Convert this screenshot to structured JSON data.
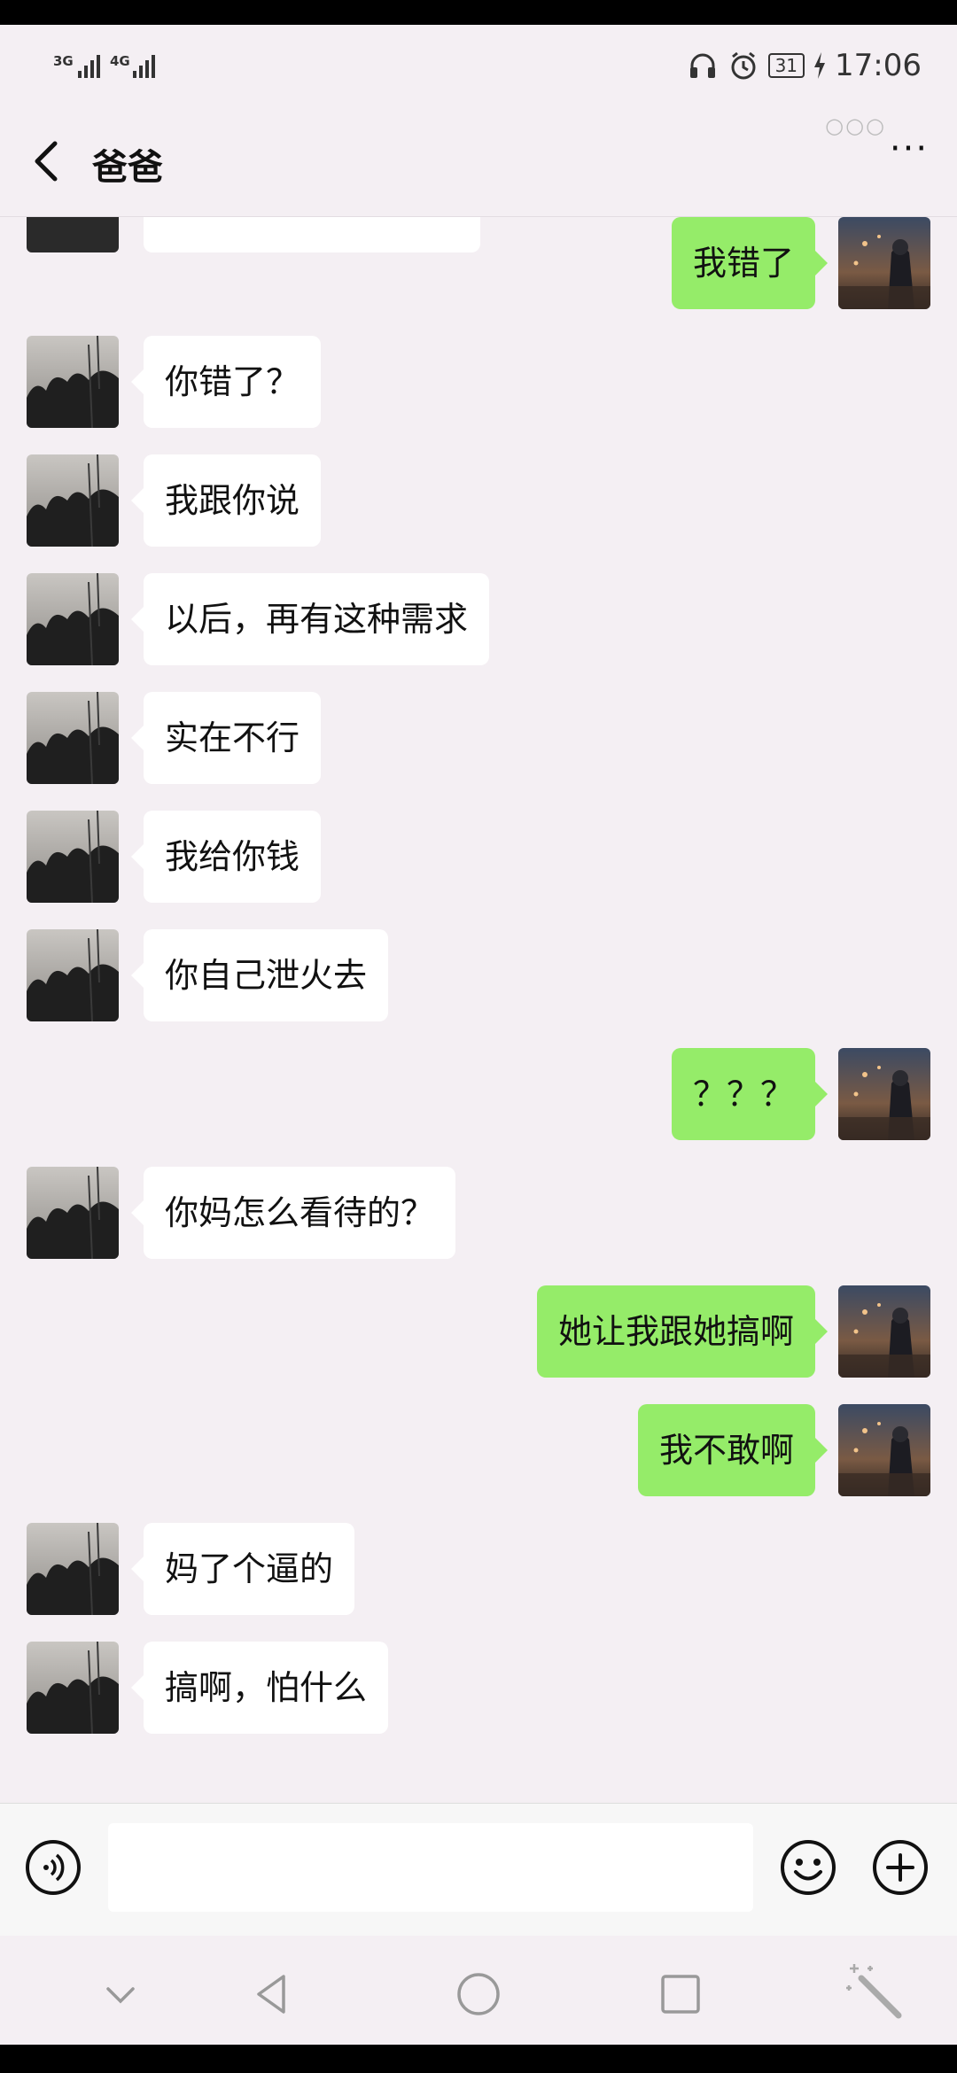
{
  "status_bar": {
    "signal_1": "3G",
    "signal_2": "4G",
    "battery": "31",
    "time": "17:06",
    "icons": [
      "headphones-icon",
      "alarm-icon",
      "charging-icon"
    ]
  },
  "header": {
    "title": "爸爸",
    "back_icon": "chevron-left-icon",
    "more_icon": "more-dots-icon",
    "more_glyph": "···",
    "miniprogram_glyph": "○○○"
  },
  "messages": [
    {
      "side": "right",
      "text": "我错了"
    },
    {
      "side": "left",
      "text": "你错了？"
    },
    {
      "side": "left",
      "text": "我跟你说"
    },
    {
      "side": "left",
      "text": "以后，再有这种需求"
    },
    {
      "side": "left",
      "text": "实在不行"
    },
    {
      "side": "left",
      "text": "我给你钱"
    },
    {
      "side": "left",
      "text": "你自己泄火去"
    },
    {
      "side": "right",
      "text": "？？？"
    },
    {
      "side": "left",
      "text": "你妈怎么看待的？"
    },
    {
      "side": "right",
      "text": "她让我跟她搞啊"
    },
    {
      "side": "right",
      "text": "我不敢啊"
    },
    {
      "side": "left",
      "text": "妈了个逼的"
    },
    {
      "side": "left",
      "text": "搞啊，怕什么"
    }
  ],
  "input_bar": {
    "voice_icon": "voice-icon",
    "emoji_icon": "emoji-icon",
    "plus_icon": "plus-icon",
    "text": ""
  },
  "nav_bar": {
    "icons": [
      "chevron-down-icon",
      "back-triangle-icon",
      "home-circle-icon",
      "recents-square-icon",
      "magic-wand-icon"
    ]
  },
  "colors": {
    "background": "#f4eff3",
    "bubble_self": "#95ec69",
    "bubble_other": "#ffffff"
  }
}
